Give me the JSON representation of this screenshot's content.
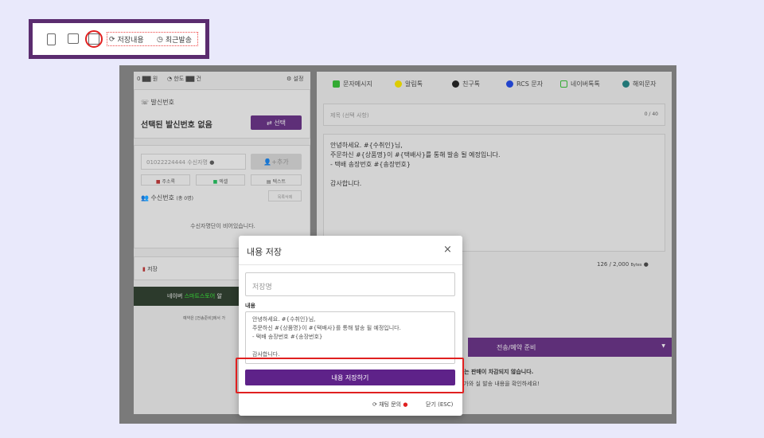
{
  "inset": {
    "tools": [
      "template-icon",
      "image-add-icon",
      "save-icon"
    ],
    "saved_label": "저장내용",
    "recent_label": "최근발송"
  },
  "left": {
    "top_a": "0",
    "top_a2": "원",
    "top_b": "한도",
    "top_b2": "건",
    "settings": "설정",
    "sender_title": "발신번호",
    "no_sender": "선택된 발신번호 없음",
    "select_btn": "⇄ 선택",
    "recipient_placeholder": "01022224444 수신자명",
    "add_btn": "추가",
    "addr_btn": "주소록",
    "excel_btn": "엑셀",
    "text_btn": "텍스트",
    "recipients_title": "수신번호",
    "recipients_count": "(총 0명)",
    "clear_btn": "목록삭제",
    "empty_msg": "수신자명단이 비어있습니다.",
    "storage": "저장",
    "banner_a": "네이버",
    "banner_b": "스마트스토어",
    "banner_c": "알",
    "footer_note": "예약은 [전송준비]에서 가"
  },
  "right": {
    "tabs": [
      "문자메시지",
      "알림톡",
      "친구톡",
      "RCS 문자",
      "네이버톡톡",
      "해외문자"
    ],
    "subject_placeholder": "제목 (선택 사항)",
    "subject_count": "0 / 40",
    "body_lines": [
      "안녕하세요. #{수취인}님,",
      "주문하신 #{상품명}이 #{택배사}를 통해 발송 될 예정입니다.",
      "- 택배 송장번호 #{송장번호}",
      "",
      "감사합니다."
    ],
    "bytes": "126 / 2,000",
    "bytes_unit": "Bytes",
    "send_btn": "전송/예약 준비",
    "note1": "비\"는 판매이 차감되지 않습니다.",
    "note2": "단가와 실 발송 내용을 확인하세요!"
  },
  "dialog": {
    "title": "내용 저장",
    "name_placeholder": "저장명",
    "content_label": "내용",
    "content": "안녕하세요. #{수취인}님,\n주문하신 #{상품명}이 #{택배사}를 통해 발송 될 예정입니다.\n- 택배 송장번호 #{송장번호}\n\n감사합니다.",
    "save_btn": "내용 저장하기",
    "chat_link": "채팅 문의",
    "close_link": "닫기 (ESC)"
  },
  "colors": {
    "accent": "#5e2289",
    "highlight": "#e02020",
    "frame": "#5b2c6f"
  }
}
